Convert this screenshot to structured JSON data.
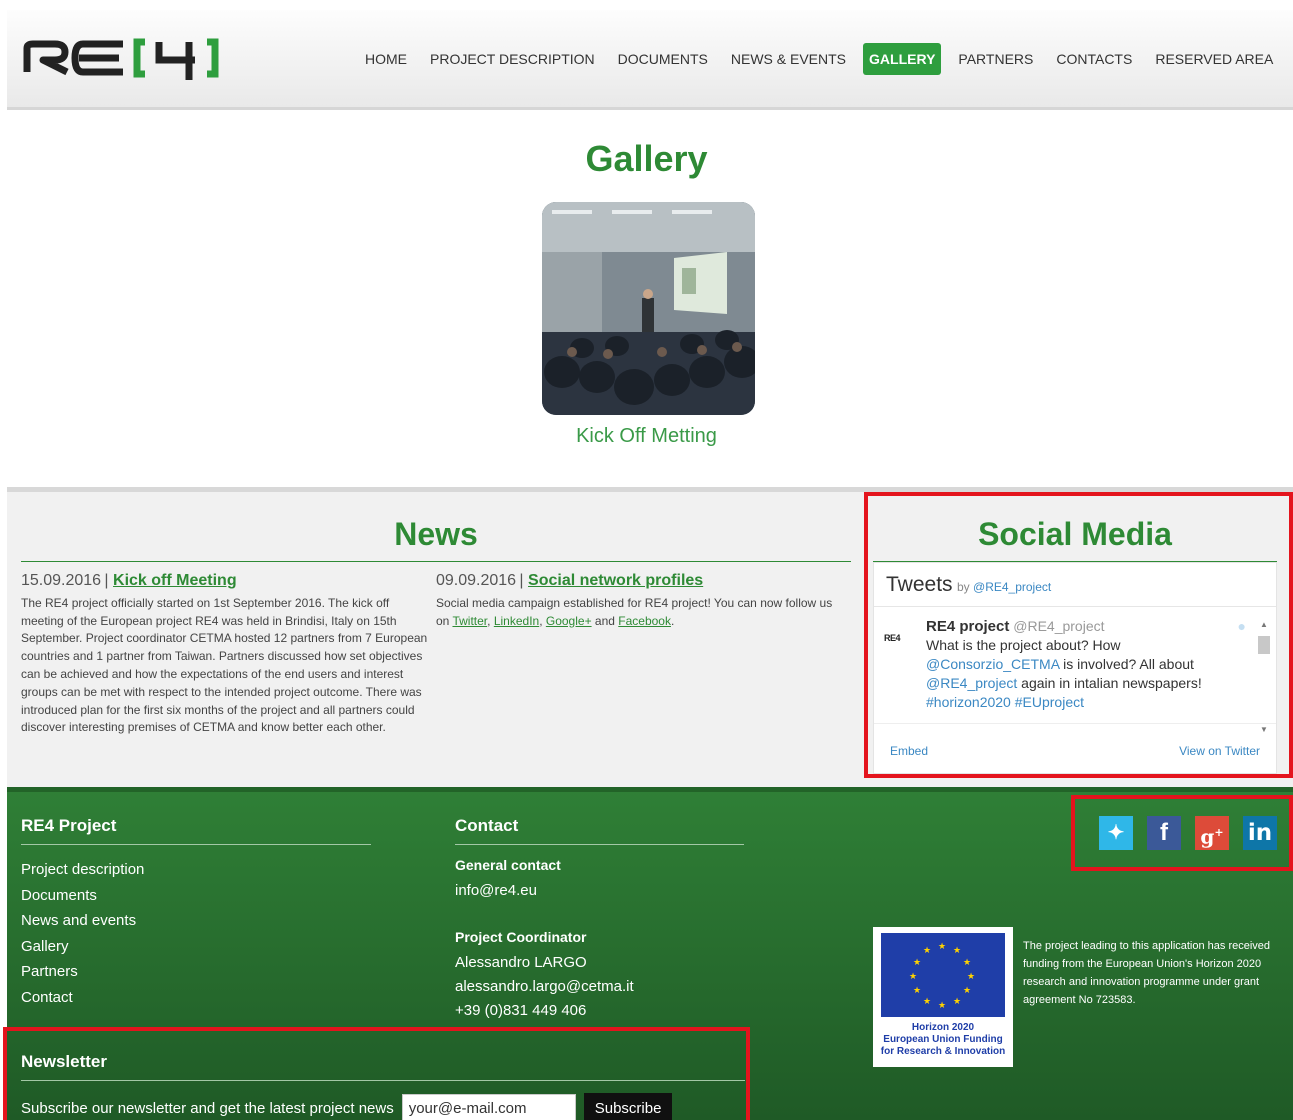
{
  "header": {
    "logo_text": "RE4",
    "nav": [
      {
        "label": "HOME",
        "active": false
      },
      {
        "label": "PROJECT DESCRIPTION",
        "active": false
      },
      {
        "label": "DOCUMENTS",
        "active": false
      },
      {
        "label": "NEWS & EVENTS",
        "active": false
      },
      {
        "label": "GALLERY",
        "active": true
      },
      {
        "label": "PARTNERS",
        "active": false
      },
      {
        "label": "CONTACTS",
        "active": false
      },
      {
        "label": "RESERVED AREA",
        "active": false
      }
    ]
  },
  "gallery": {
    "title": "Gallery",
    "caption": "Kick Off Metting"
  },
  "news": {
    "heading": "News",
    "items": [
      {
        "date": "15.09.2016",
        "title": "Kick off Meeting",
        "body": "The RE4 project officially started on 1st September 2016. The kick off meeting of the European project RE4 was held in Brindisi, Italy on 15th September. Project coordinator CETMA hosted 12 partners from 7 European countries and 1 partner from Taiwan. Partners discussed how set objectives can be achieved and how the expectations of the end users and interest groups can be met with respect to the intended project outcome. There was introduced plan for the first six months of the project and all partners could discover interesting premises of CETMA and know better each other."
      },
      {
        "date": "09.09.2016",
        "title": "Social network profiles",
        "body_start": "Social media campaign established for RE4 project! You can now follow us on ",
        "links": [
          "Twitter",
          "LinkedIn",
          "Google+",
          "Facebook"
        ],
        "sep1": ", ",
        "sep_and": " and ",
        "end": "."
      }
    ]
  },
  "social": {
    "heading": "Social Media",
    "widget_title": "Tweets",
    "widget_by": "by",
    "widget_handle": "@RE4_project",
    "tweet_logo": "RE4",
    "tweet_author": "RE4 project",
    "tweet_handle": "@RE4_project",
    "tweet_text_1": "What is the project about? How",
    "tweet_mention_1": "@Consorzio_CETMA",
    "tweet_text_2": " is involved? All about",
    "tweet_mention_2": "@RE4_project",
    "tweet_text_3": " again in intalian newspapers!",
    "tweet_tags": "#horizon2020 #EUproject",
    "embed": "Embed",
    "view": "View on Twitter"
  },
  "footer": {
    "project_title": "RE4 Project",
    "links": [
      "Project description",
      "Documents",
      "News and events",
      "Gallery",
      "Partners",
      "Contact"
    ],
    "contact_title": "Contact",
    "general_label": "General contact",
    "general_email": "info@re4.eu",
    "coord_label": "Project Coordinator",
    "coord_name": "Alessandro LARGO",
    "coord_email": "alessandro.largo@cetma.it",
    "coord_phone": "+39 (0)831 449 406",
    "eu_line1": "Horizon 2020",
    "eu_line2": "European Union Funding",
    "eu_line3": "for Research & Innovation",
    "eu_desc": "The project leading to this application has received funding from the European Union's Horizon 2020 research and innovation programme under grant agreement No 723583.",
    "social_icons": [
      "twitter-icon",
      "facebook-icon",
      "google-plus-icon",
      "linkedin-icon"
    ]
  },
  "newsletter": {
    "title": "Newsletter",
    "text": "Subscribe our newsletter and get the latest project news",
    "value": "your@e-mail.com",
    "button": "Subscribe"
  },
  "colors": {
    "brand_green": "#2e8a35",
    "nav_active": "#2e9e3e",
    "footer_green": "#2f7f36",
    "highlight_red": "#e4141d",
    "link_blue": "#3b88c3"
  }
}
